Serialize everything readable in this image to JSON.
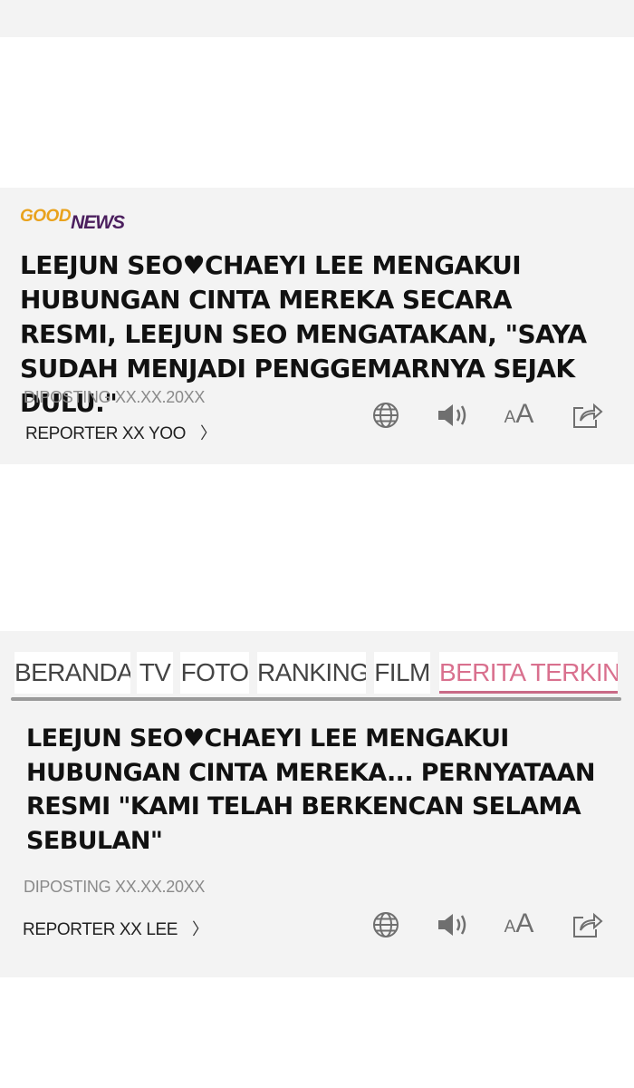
{
  "articles": [
    {
      "logo": {
        "good": "GOOD",
        "news": "NEWS"
      },
      "headline": "LEEJUN SEO♥CHAEYI LEE MENGAKUI HUBUNGAN CINTA MEREKA SECARA RESMI, LEEJUN SEO MENGATAKAN, \"SAYA SUDAH MENJADI PENGGEMARNYA SEJAK DULU.\"",
      "posted": "DIPOSTING XX.XX.20XX",
      "reporter": "REPORTER XX YOO",
      "reporter_chevron": "〉",
      "font_small": "A",
      "font_big": "A"
    },
    {
      "headline": "LEEJUN SEO♥CHAEYI LEE MENGAKUI HUBUNGAN CINTA MEREKA... PERNYATAAN RESMI \"KAMI TELAH BERKENCAN SELAMA SEBULAN\"",
      "posted": "DIPOSTING XX.XX.20XX",
      "reporter": "REPORTER XX LEE",
      "reporter_chevron": "〉",
      "font_small": "A",
      "font_big": "A"
    }
  ],
  "nav": {
    "tabs": [
      {
        "label": "BERANDA"
      },
      {
        "label": "TV"
      },
      {
        "label": "FOTO"
      },
      {
        "label": "RANKING"
      },
      {
        "label": "FILM"
      },
      {
        "label": "BERITA TERKINI"
      }
    ],
    "active_index": 5
  },
  "toolbar_icons": [
    "globe-icon",
    "speaker-icon",
    "font-size-icon",
    "share-icon"
  ],
  "colors": {
    "panel_bg": "#f3f3f3",
    "active_tab": "#d9708e",
    "logo_good": "#e9a21c",
    "logo_news": "#4b1f5e",
    "icon_gray": "#6f6f6f"
  }
}
